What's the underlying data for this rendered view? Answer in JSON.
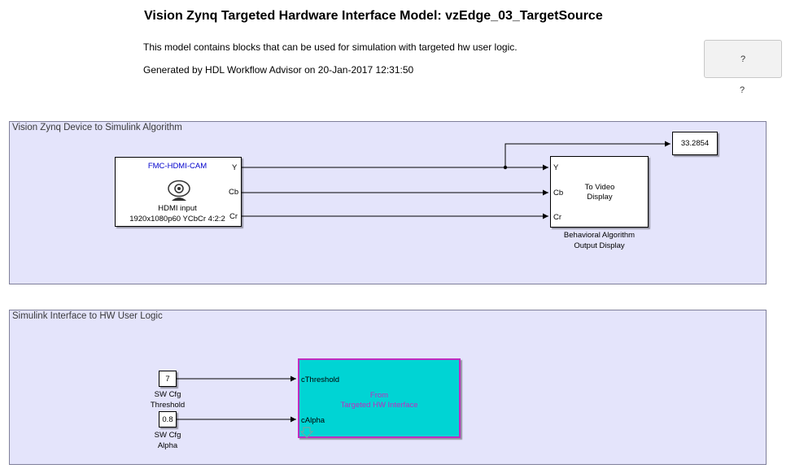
{
  "header": {
    "title": "Vision Zynq Targeted Hardware Interface Model: vzEdge_03_TargetSource",
    "description": "This model contains blocks that can be used for simulation with targeted hw user logic.",
    "generated": "Generated by HDL Workflow Advisor on 20-Jan-2017 12:31:50",
    "help_button": "?",
    "help_caption": "?"
  },
  "area_top": {
    "label": "Vision Zynq Device to Simulink Algorithm",
    "source_block": {
      "name": "FMC-HDMI-CAM",
      "caption_line1": "HDMI input",
      "caption_line2": "1920x1080p60 YCbCr 4:2:2",
      "ports": [
        "Y",
        "Cb",
        "Cr"
      ]
    },
    "display_block": {
      "label_line1": "To Video",
      "label_line2": "Display",
      "ports": [
        "Y",
        "Cb",
        "Cr"
      ],
      "caption_line1": "Behavioral Algorithm",
      "caption_line2": "Output Display"
    },
    "scope_value": "33.2854"
  },
  "area_bottom": {
    "label": "Simulink Interface to HW User Logic",
    "threshold": {
      "value": "7",
      "caption_line1": "SW Cfg",
      "caption_line2": "Threshold"
    },
    "alpha": {
      "value": "0.8",
      "caption_line1": "SW Cfg",
      "caption_line2": "Alpha"
    },
    "hw_block": {
      "label_line1": "From",
      "label_line2": "Targeted HW Interface",
      "ports": [
        "cThreshold",
        "cAlpha"
      ],
      "label_color": "#c02cc0",
      "fill_color": "#00d4d4"
    }
  },
  "colors": {
    "area_fill": "#e4e4fb",
    "title_blue": "#0000cc"
  }
}
